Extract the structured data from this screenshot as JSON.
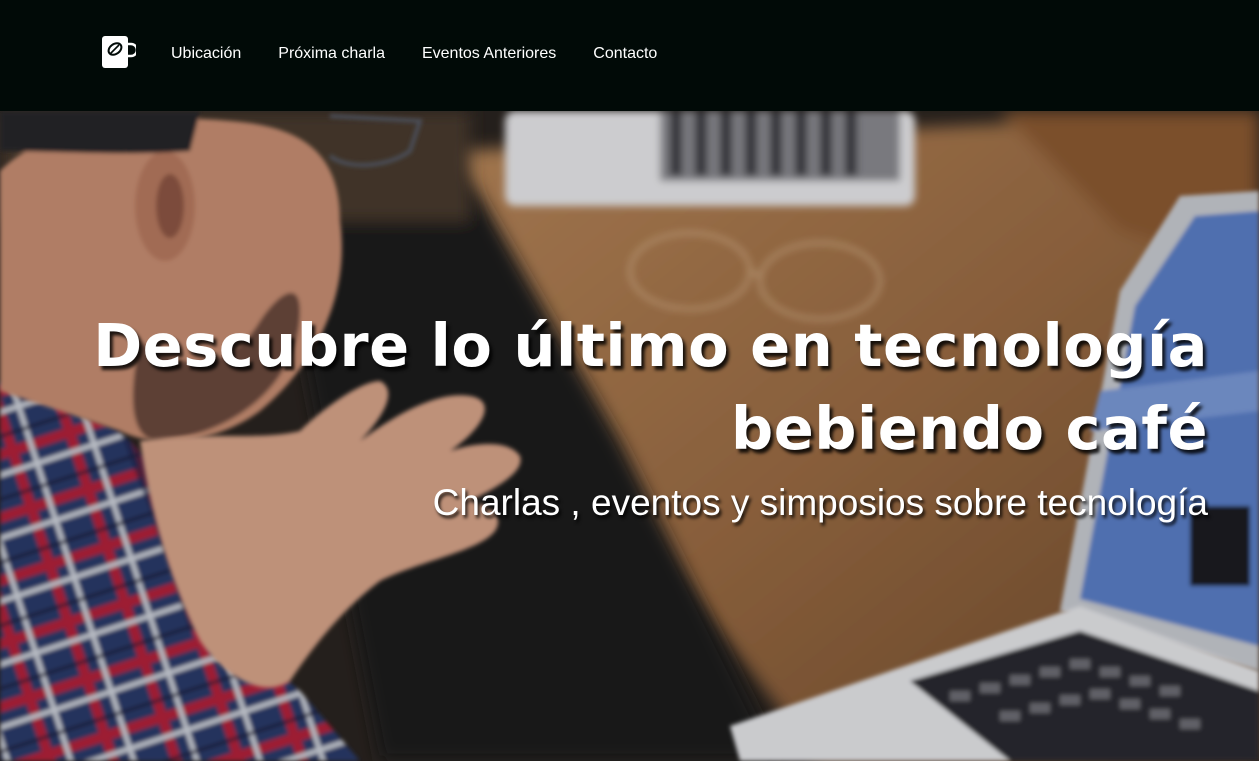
{
  "nav": {
    "logo_icon": "coffee-cup-leaf-icon",
    "links": [
      {
        "label": "Ubicación"
      },
      {
        "label": "Próxima charla"
      },
      {
        "label": "Eventos Anteriores"
      },
      {
        "label": "Contacto"
      }
    ]
  },
  "hero": {
    "title": "Descubre lo último en tecnología bebiendo café",
    "subtitle": "Charlas , eventos y simposios sobre tecnología",
    "background": "photo-man-with-laptops-at-wooden-table"
  },
  "colors": {
    "navbar_bg": "#010a07",
    "text": "#ffffff"
  }
}
